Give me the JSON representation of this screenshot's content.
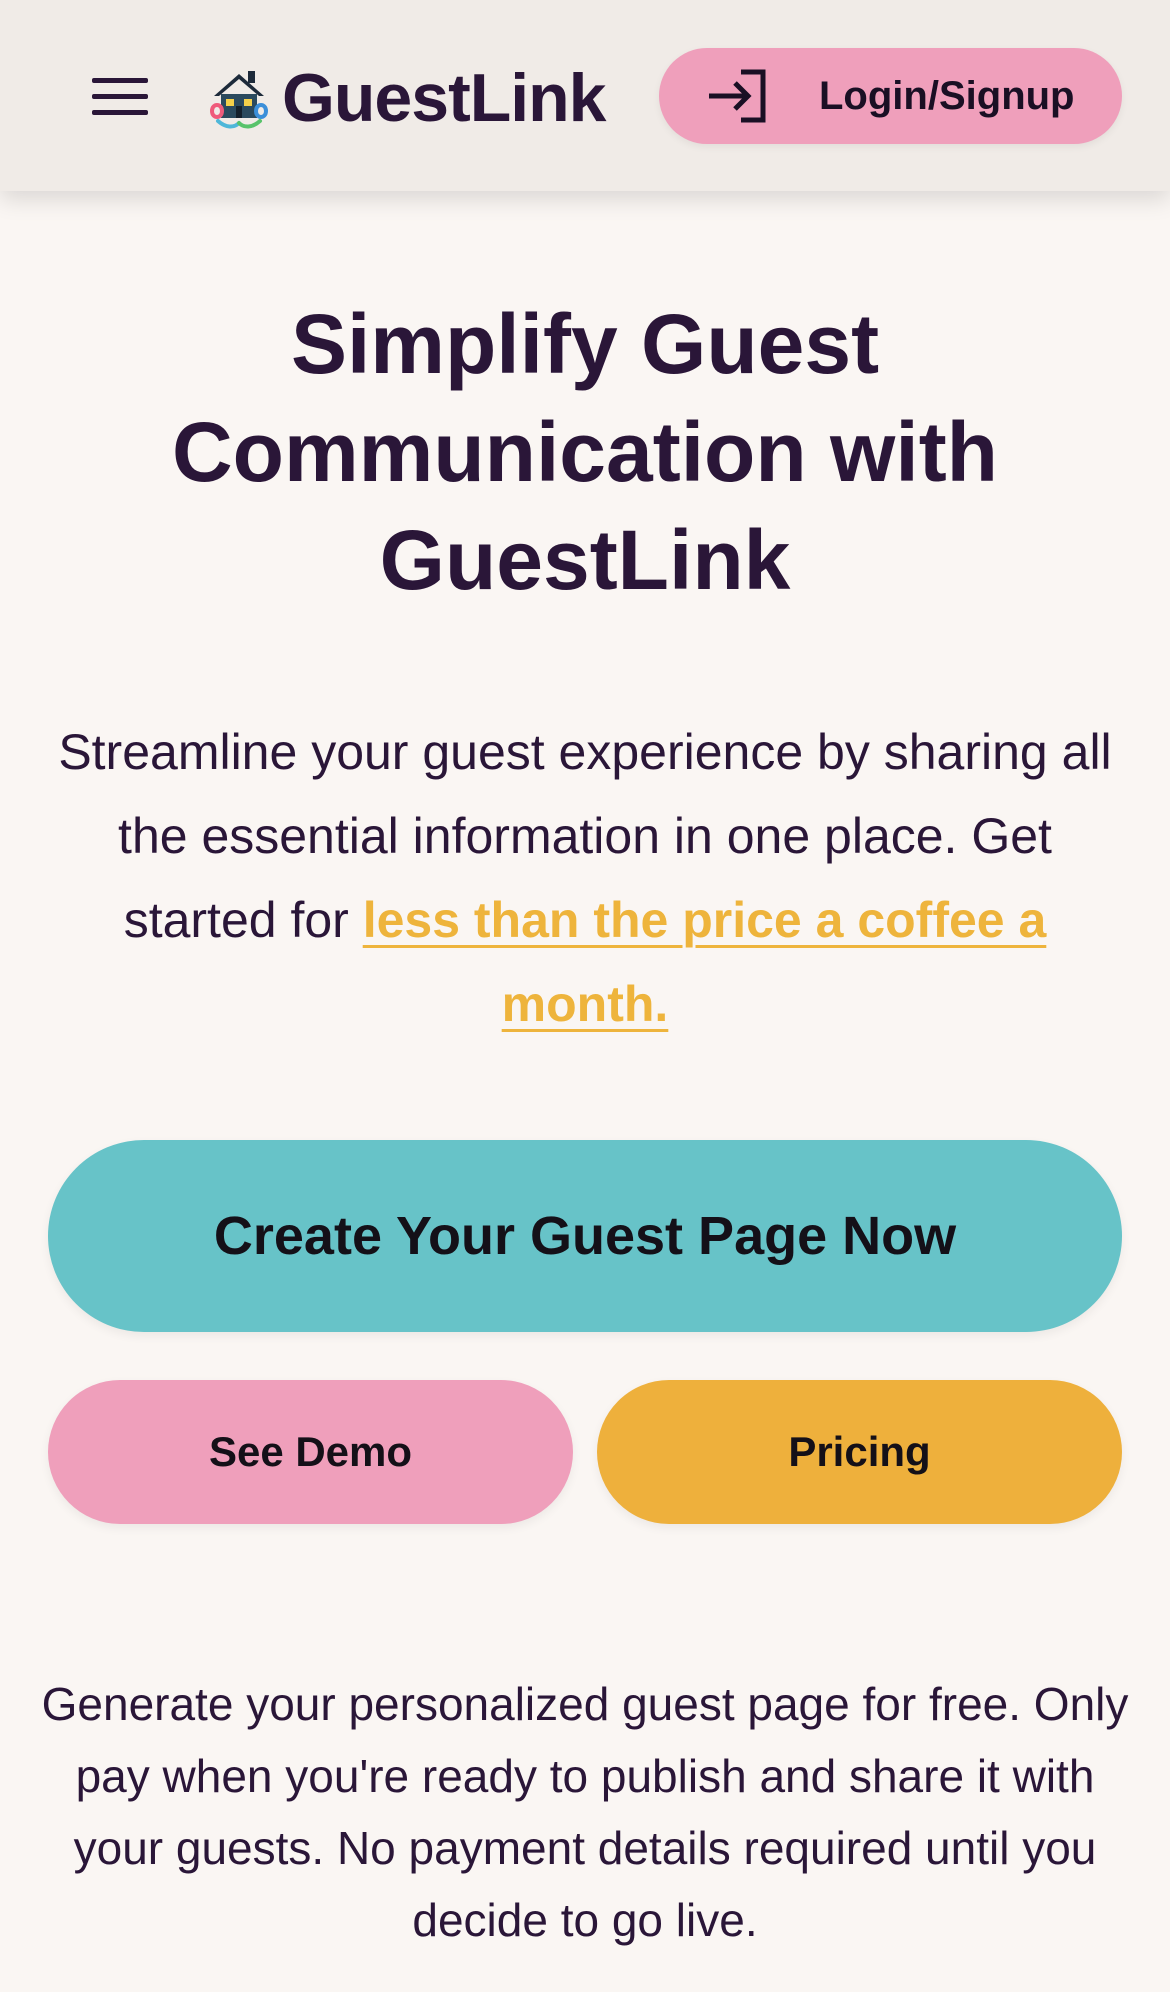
{
  "header": {
    "menu_icon": "hamburger-menu-icon",
    "logo_icon": "house-link-logo-icon",
    "brand_name": "GuestLink",
    "login": {
      "icon": "login-arrow-icon",
      "label": "Login/Signup"
    }
  },
  "hero": {
    "title": "Simplify Guest Communication with GuestLink",
    "subtitle_part1": "Streamline your guest experience by sharing all the essential information in one place. Get started for ",
    "subtitle_link": "less than the price a coffee a month."
  },
  "actions": {
    "primary_label": "Create Your Guest Page Now",
    "demo_label": "See Demo",
    "pricing_label": "Pricing"
  },
  "free_note": "Generate your personalized guest page for free. Only pay when you're ready to publish and share it with your guests. No payment details required until you decide to go live.",
  "colors": {
    "background": "#faf6f3",
    "header_bg": "#f0ebe7",
    "text": "#2a1638",
    "pink": "#ef9fbb",
    "teal": "#67c3c8",
    "amber": "#eeb03c",
    "link": "#eeb43c"
  }
}
